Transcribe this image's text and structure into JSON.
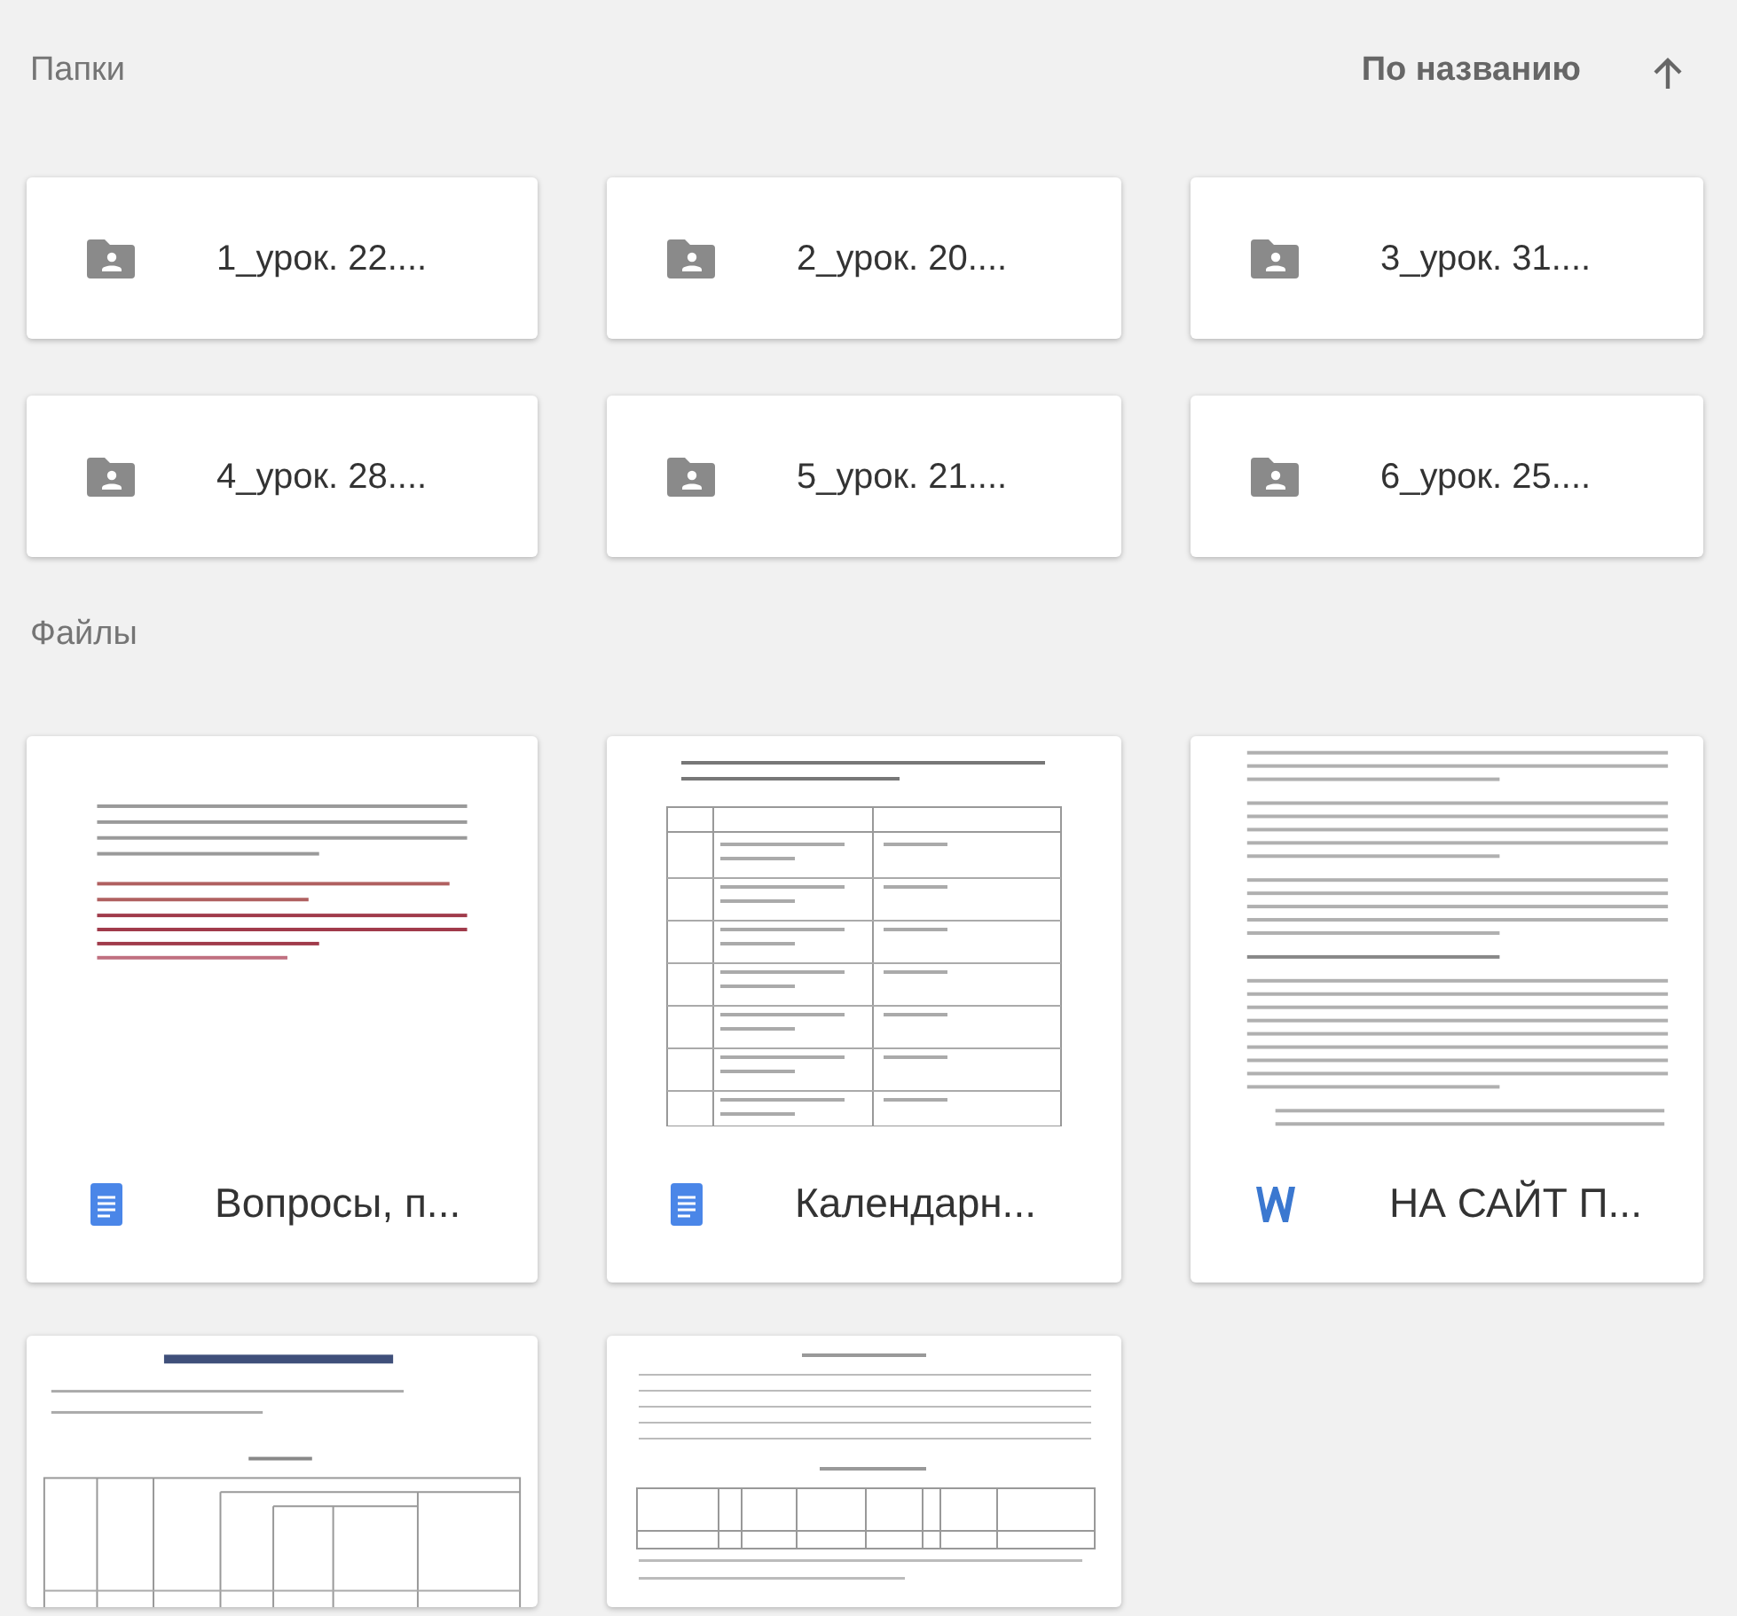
{
  "folders_section": {
    "title": "Папки",
    "sort": {
      "label": "По названию"
    }
  },
  "folders": [
    {
      "name": "1_урок. 22...."
    },
    {
      "name": "2_урок. 20...."
    },
    {
      "name": "3_урок. 31...."
    },
    {
      "name": "4_урок. 28...."
    },
    {
      "name": "5_урок. 21...."
    },
    {
      "name": "6_урок. 25...."
    }
  ],
  "files_section": {
    "title": "Файлы"
  },
  "files": [
    {
      "name": "Вопросы, п...",
      "kind": "gdoc",
      "preview": {
        "kind": "letter"
      }
    },
    {
      "name": "Календарн...",
      "kind": "gdoc",
      "preview": {
        "kind": "table"
      }
    },
    {
      "name": "НА САЙТ П...",
      "kind": "word",
      "preview": {
        "kind": "text"
      }
    },
    {
      "preview": {
        "kind": "lesson-map"
      }
    },
    {
      "preview": {
        "kind": "form"
      }
    }
  ]
}
